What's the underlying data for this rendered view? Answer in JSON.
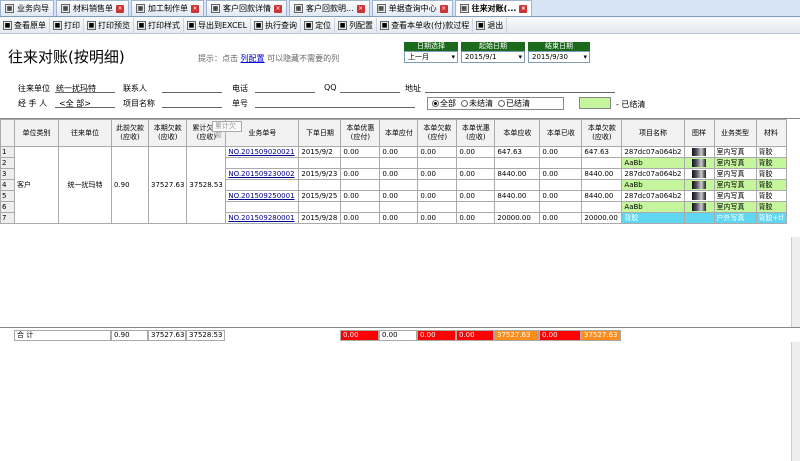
{
  "tabs": [
    {
      "label": "业务向导",
      "icon": "home-icon"
    },
    {
      "label": "材料销售单",
      "icon": "doc-icon"
    },
    {
      "label": "加工制作单",
      "icon": "doc-icon"
    },
    {
      "label": "客户回款详情",
      "icon": "doc-icon"
    },
    {
      "label": "客户回款明...",
      "icon": "doc-icon"
    },
    {
      "label": "单据查询中心",
      "icon": "doc-icon"
    },
    {
      "label": "往来对账(...",
      "icon": "doc-icon"
    }
  ],
  "toolbar": [
    {
      "label": "查看原单",
      "icon": "view-icon"
    },
    {
      "label": "打印",
      "icon": "print-icon"
    },
    {
      "label": "打印预览",
      "icon": "preview-icon"
    },
    {
      "label": "打印样式",
      "icon": "style-icon"
    },
    {
      "label": "导出到EXCEL",
      "icon": "excel-icon"
    },
    {
      "label": "执行查询",
      "icon": "query-icon"
    },
    {
      "label": "定位",
      "icon": "locate-icon"
    },
    {
      "label": "列配置",
      "icon": "columns-icon"
    },
    {
      "label": "查看本单收(付)款过程",
      "icon": "process-icon"
    },
    {
      "label": "退出",
      "icon": "exit-icon"
    }
  ],
  "page_title": "往来对账(按明细)",
  "hint": {
    "prefix": "提示：点击",
    "link": "列配置",
    "suffix": "可以隐藏不需要的列"
  },
  "date_select": {
    "h1": "日期选择",
    "v1": "上一月",
    "h2": "起始日期",
    "v2": "2015/9/1",
    "h3": "结束日期",
    "v3": "2015/9/30"
  },
  "filters": {
    "unit_label": "往来单位",
    "unit_value": "统一扰玛特",
    "contact_label": "联系人",
    "phone_label": "电话",
    "qq_label": "QQ",
    "address_label": "地址",
    "handler_label": "经 手 人",
    "handler_value": "<全 部>",
    "project_label": "项目名称",
    "docno_label": "单号",
    "radio_all": "全部",
    "radio_open": "未结清",
    "radio_closed": "已结清",
    "legend_label": "- 已结清"
  },
  "tooltip": "累计欠款",
  "columns": [
    "",
    "单位类别",
    "往来单位",
    "此前欠款(应收)",
    "本期欠款(应收)",
    "累计欠款(应收)",
    "业务单号",
    "下单日期",
    "本单优惠(应付)",
    "本单应付",
    "本单欠款(应付)",
    "本单优惠(应收)",
    "本单应收",
    "本单已收",
    "本单欠款(应收)",
    "项目名称",
    "图样",
    "业务类型",
    "材料"
  ],
  "group": {
    "category": "客户",
    "unit": "统一扰玛特",
    "prev": "0.90",
    "period": "37527.63",
    "total": "37528.53"
  },
  "rows": [
    {
      "n": "1",
      "doc": "NO.201509020021",
      "date": "2015/9/2",
      "d1": "0.00",
      "pay": "0.00",
      "d2": "0.00",
      "d3": "0.00",
      "rec": "647.63",
      "got": "0.00",
      "owe": "647.63",
      "proj": "287dc07a064b2",
      "type": "室内写真",
      "mat": "背胶"
    },
    {
      "n": "2",
      "doc": "",
      "date": "",
      "d1": "",
      "pay": "",
      "d2": "",
      "d3": "",
      "rec": "",
      "got": "",
      "owe": "",
      "proj": "AaBb",
      "type": "室内写真",
      "mat": "背胶",
      "green": true
    },
    {
      "n": "3",
      "doc": "NO.201509230002",
      "date": "2015/9/23",
      "d1": "0.00",
      "pay": "0.00",
      "d2": "0.00",
      "d3": "0.00",
      "rec": "8440.00",
      "got": "0.00",
      "owe": "8440.00",
      "proj": "287dc07a064b2",
      "type": "室内写真",
      "mat": "背胶"
    },
    {
      "n": "4",
      "doc": "",
      "date": "",
      "d1": "",
      "pay": "",
      "d2": "",
      "d3": "",
      "rec": "",
      "got": "",
      "owe": "",
      "proj": "AaBb",
      "type": "室内写真",
      "mat": "背胶",
      "green": true
    },
    {
      "n": "5",
      "doc": "NO.201509250001",
      "date": "2015/9/25",
      "d1": "0.00",
      "pay": "0.00",
      "d2": "0.00",
      "d3": "0.00",
      "rec": "8440.00",
      "got": "0.00",
      "owe": "8440.00",
      "proj": "287dc07a064b2",
      "type": "室内写真",
      "mat": "背胶"
    },
    {
      "n": "6",
      "doc": "",
      "date": "",
      "d1": "",
      "pay": "",
      "d2": "",
      "d3": "",
      "rec": "",
      "got": "",
      "owe": "",
      "proj": "AaBb",
      "type": "室内写真",
      "mat": "背胶",
      "green": true
    },
    {
      "n": "7",
      "doc": "NO.201509280001",
      "date": "2015/9/28",
      "d1": "0.00",
      "pay": "0.00",
      "d2": "0.00",
      "d3": "0.00",
      "rec": "20000.00",
      "got": "0.00",
      "owe": "20000.00",
      "proj": "背胶",
      "type": "户外写真",
      "mat": "背胶+tf",
      "cyan": true
    }
  ],
  "footer": {
    "label": "合 计",
    "prev": "0.90",
    "period": "37527.63",
    "total": "37528.53",
    "d1": "0.00",
    "pay": "0.00",
    "d2": "0.00",
    "d3": "0.00",
    "rec": "37527.63",
    "got": "0.00",
    "owe": "37527.63"
  },
  "colors": {
    "red": "#ff0000",
    "orange": "#ff8c1a",
    "green": "#c5f59c",
    "cyan": "#5fd7f3"
  }
}
